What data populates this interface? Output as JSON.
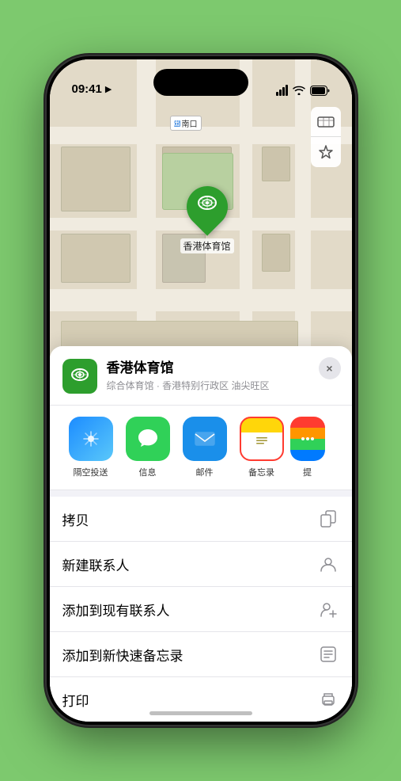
{
  "statusBar": {
    "time": "09:41",
    "locationArrow": "▶"
  },
  "map": {
    "label": "南口",
    "labelPrefix": "出",
    "controls": {
      "mapTypeIcon": "🗺",
      "locationIcon": "➤"
    }
  },
  "stadiumPin": {
    "icon": "🏟",
    "label": "香港体育馆"
  },
  "placeCard": {
    "name": "香港体育馆",
    "subtitle": "综合体育馆 · 香港特别行政区 油尖旺区",
    "closeLabel": "×"
  },
  "shareItems": [
    {
      "id": "airdrop",
      "label": "隔空投送",
      "icon": "📡",
      "bg": "airdrop"
    },
    {
      "id": "messages",
      "label": "信息",
      "icon": "💬",
      "bg": "messages"
    },
    {
      "id": "mail",
      "label": "邮件",
      "icon": "✉",
      "bg": "mail"
    },
    {
      "id": "notes",
      "label": "备忘录",
      "icon": "📝",
      "bg": "notes",
      "highlighted": true
    },
    {
      "id": "more",
      "label": "提",
      "icon": "···",
      "bg": "more"
    }
  ],
  "actionItems": [
    {
      "id": "copy",
      "label": "拷贝",
      "icon": "copy"
    },
    {
      "id": "new-contact",
      "label": "新建联系人",
      "icon": "person"
    },
    {
      "id": "add-existing",
      "label": "添加到现有联系人",
      "icon": "person-add"
    },
    {
      "id": "quick-note",
      "label": "添加到新快速备忘录",
      "icon": "note"
    },
    {
      "id": "print",
      "label": "打印",
      "icon": "print"
    }
  ],
  "colors": {
    "green": "#2d9e2d",
    "highlight": "#ff3b30",
    "background": "#7dc96e"
  }
}
